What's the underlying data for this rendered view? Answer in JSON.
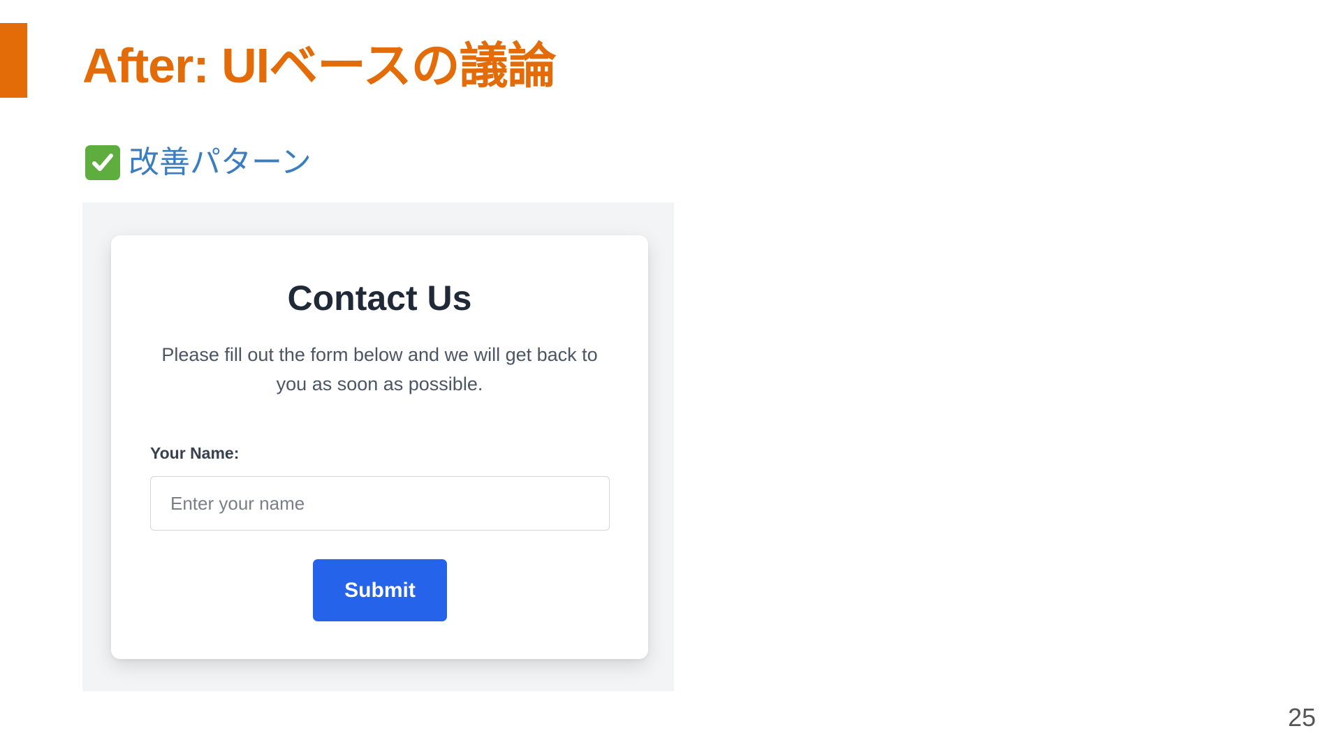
{
  "slide": {
    "title": "After: UIベースの議論",
    "subtitle": "改善パターン",
    "subtitle_icon": "check-mark-icon",
    "page_number": "25",
    "accent_color": "#E36C09",
    "subtitle_color": "#3A7DC0"
  },
  "form": {
    "heading": "Contact Us",
    "description": "Please fill out the form below and we will get back to you as soon as possible.",
    "name_label": "Your Name:",
    "name_placeholder": "Enter your name",
    "name_value": "",
    "submit_label": "Submit",
    "button_color": "#2563EB"
  }
}
